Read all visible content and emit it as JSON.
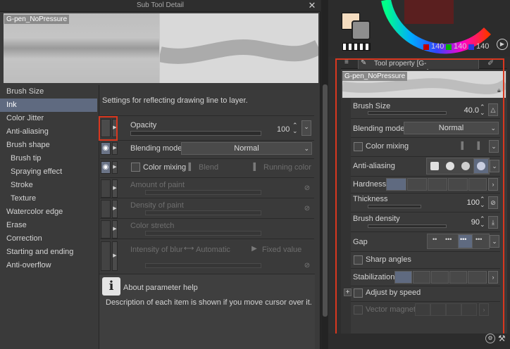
{
  "sub_tool_detail": {
    "window_title": "Sub Tool Detail",
    "close_glyph": "✕",
    "brush_preview_label": "G-pen_NoPressure",
    "categories": [
      {
        "label": "Brush Size",
        "sub": false,
        "selected": false
      },
      {
        "label": "Ink",
        "sub": false,
        "selected": true
      },
      {
        "label": "Color Jitter",
        "sub": false,
        "selected": false
      },
      {
        "label": "Anti-aliasing",
        "sub": false,
        "selected": false
      },
      {
        "label": "Brush shape",
        "sub": false,
        "selected": false
      },
      {
        "label": "Brush tip",
        "sub": true,
        "selected": false
      },
      {
        "label": "Spraying effect",
        "sub": true,
        "selected": false
      },
      {
        "label": "Stroke",
        "sub": true,
        "selected": false
      },
      {
        "label": "Texture",
        "sub": true,
        "selected": false
      },
      {
        "label": "Watercolor edge",
        "sub": false,
        "selected": false
      },
      {
        "label": "Erase",
        "sub": false,
        "selected": false
      },
      {
        "label": "Correction",
        "sub": false,
        "selected": false
      },
      {
        "label": "Starting and ending",
        "sub": false,
        "selected": false
      },
      {
        "label": "Anti-overflow",
        "sub": false,
        "selected": false
      }
    ],
    "settings_note": "Settings for reflecting drawing line to layer.",
    "opacity": {
      "label": "Opacity",
      "value": "100"
    },
    "blending_mode": {
      "label": "Blending mode",
      "value": "Normal"
    },
    "color_mixing": {
      "label": "Color mixing",
      "blend_label": "Blend",
      "running_label": "Running color"
    },
    "amount_of_paint": {
      "label": "Amount of paint"
    },
    "density_of_paint": {
      "label": "Density of paint"
    },
    "color_stretch": {
      "label": "Color stretch"
    },
    "intensity_of_blur": {
      "label": "Intensity of blur",
      "automatic_label": "Automatic",
      "fixed_label": "Fixed value"
    },
    "help": {
      "icon_glyph": "i",
      "title": "About parameter help",
      "description": "Description of each item is shown if you move cursor over it."
    }
  },
  "color": {
    "foreground": "#f5ddc0",
    "background": "#8e8e8e",
    "r": "140",
    "g": "140",
    "b": "140",
    "play_glyph": "▶"
  },
  "tool_property": {
    "tab_title": "Tool property [G-pen_NoPressure]",
    "preview_label": "G-pen_NoPressure",
    "brush_size": {
      "label": "Brush Size",
      "value": "40.0"
    },
    "blending_mode": {
      "label": "Blending mode",
      "value": "Normal"
    },
    "color_mixing": {
      "label": "Color mixing"
    },
    "anti_aliasing": {
      "label": "Anti-aliasing"
    },
    "hardness": {
      "label": "Hardness"
    },
    "thickness": {
      "label": "Thickness",
      "value": "100"
    },
    "brush_density": {
      "label": "Brush density",
      "value": "90"
    },
    "gap": {
      "label": "Gap"
    },
    "sharp_angles": {
      "label": "Sharp angles"
    },
    "stabilization": {
      "label": "Stabilization"
    },
    "adjust_by_speed": {
      "label": "Adjust by speed"
    },
    "vector_magnet": {
      "label": "Vector magnet"
    }
  },
  "colors": {
    "highlight": "#d9371f",
    "selection": "#5f6a80"
  }
}
